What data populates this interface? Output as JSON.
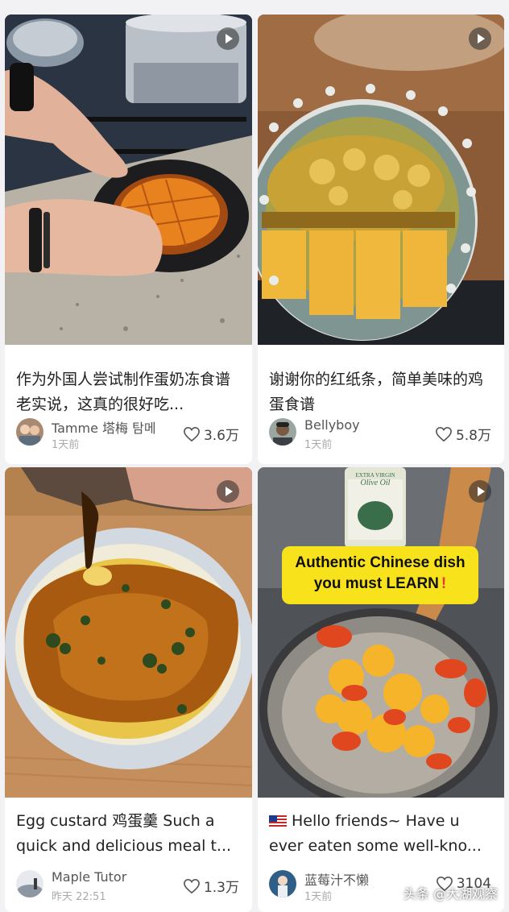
{
  "posts": [
    {
      "title": "作为外国人尝试制作蛋奶冻食谱 老实说，这真的很好吃...",
      "author": "Tamme 塔梅 탐메",
      "time": "1天前",
      "likes": "3.6万",
      "video": true
    },
    {
      "title": "谢谢你的红纸条，简单美味的鸡蛋食谱",
      "author": "Bellyboy",
      "time": "1天前",
      "likes": "5.8万",
      "video": true
    },
    {
      "title": "Egg custard 鸡蛋羹 Such a quick and delicious meal t...",
      "author": "Maple Tutor",
      "time": "昨天 22:51",
      "likes": "1.3万",
      "video": true
    },
    {
      "title": "Hello friends~ Have u ever eaten some well-kno...",
      "author": "蓝莓汁不懒",
      "time": "1天前",
      "likes": "3104",
      "video": true,
      "overlay_line1": "Authentic Chinese dish",
      "overlay_line2": "you must LEARN",
      "overlay_mark": "!",
      "bottle_label_1": "EXTRA VIRGIN",
      "bottle_label_2": "Olive Oil"
    }
  ],
  "watermark": "头条 @大湖观察",
  "colors": {
    "page_bg": "#f2f2f4",
    "card_bg": "#ffffff",
    "overlay_yellow": "#f7e21b",
    "accent_red": "#e53935"
  }
}
